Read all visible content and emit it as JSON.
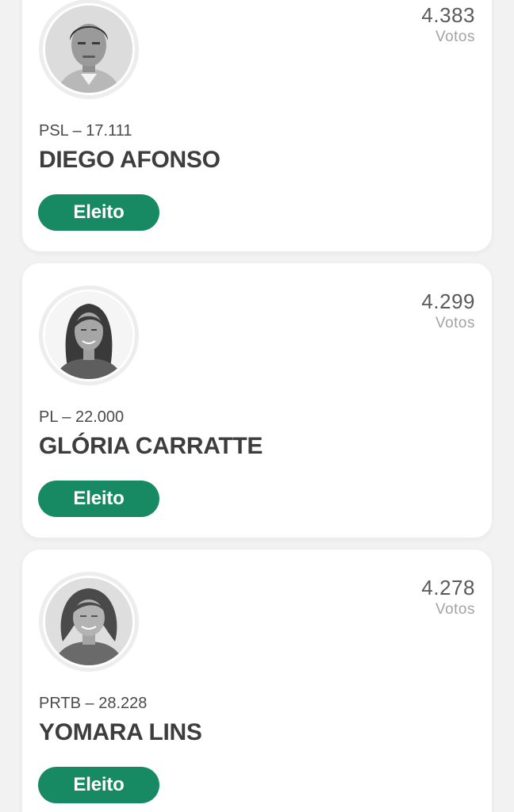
{
  "candidates": [
    {
      "name": "DIEGO AFONSO",
      "party": "PSL – 17.111",
      "votes": "4.383",
      "votes_label": "Votos",
      "status": "Eleito"
    },
    {
      "name": "GLÓRIA CARRATTE",
      "party": "PL – 22.000",
      "votes": "4.299",
      "votes_label": "Votos",
      "status": "Eleito"
    },
    {
      "name": "YOMARA LINS",
      "party": "PRTB – 28.228",
      "votes": "4.278",
      "votes_label": "Votos",
      "status": "Eleito"
    }
  ],
  "colors": {
    "badge_background": "#178a63",
    "page_background": "#f2f2f2"
  },
  "icons": [
    "candidate-photo-avatar"
  ]
}
